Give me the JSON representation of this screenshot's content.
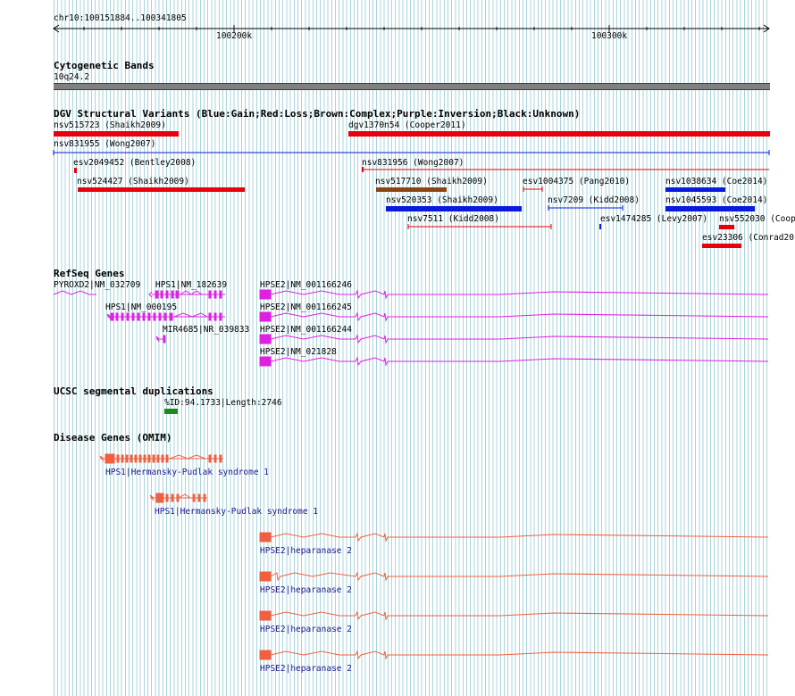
{
  "ruler": {
    "locus": "chr10:100151884..100341805",
    "ticks": [
      "100200k",
      "100300k"
    ]
  },
  "tracks": {
    "cytoband": {
      "title": "Cytogenetic Bands",
      "band": "10q24.2"
    },
    "dgv": {
      "title": "DGV Structural Variants (Blue:Gain;Red:Loss;Brown:Complex;Purple:Inversion;Black:Unknown)",
      "features": [
        "nsv515723 (Shaikh2009)",
        "dgv1370n54 (Cooper2011)",
        "nsv831955 (Wong2007)",
        "esv2049452 (Bentley2008)",
        "nsv831956 (Wong2007)",
        "nsv524427 (Shaikh2009)",
        "nsv517710 (Shaikh2009)",
        "esv1004375 (Pang2010)",
        "nsv1038634 (Coe2014)",
        "nsv520353 (Shaikh2009)",
        "nsv7209 (Kidd2008)",
        "nsv1045593 (Coe2014)",
        "nsv7511 (Kidd2008)",
        "esv1474285 (Levy2007)",
        "nsv552030 (Coop",
        "esv23306 (Conrad20"
      ]
    },
    "refseq": {
      "title": "RefSeq Genes",
      "genes": [
        "PYROXD2|NM_032709",
        "HPS1|NM_182639",
        "HPSE2|NM_001166246",
        "HPS1|NM_000195",
        "HPSE2|NM_001166245",
        "MIR4685|NR_039833",
        "HPSE2|NM_001166244",
        "HPSE2|NM_021828"
      ]
    },
    "segdup": {
      "title": "UCSC segmental duplications",
      "label": "%ID:94.1733|Length:2746"
    },
    "omim": {
      "title": "Disease Genes (OMIM)",
      "genes": [
        "HPS1|Hermansky-Pudlak syndrome 1",
        "HPS1|Hermansky-Pudlak syndrome 1",
        "HPSE2|heparanase 2",
        "HPSE2|heparanase 2",
        "HPSE2|heparanase 2",
        "HPSE2|heparanase 2"
      ]
    }
  },
  "colors": {
    "grid": "#a8d4dc",
    "loss": "#e8000a",
    "gain": "#0a1adc",
    "complex": "#8b4513",
    "refseq": "#e020e0",
    "segdup": "#188c18",
    "omim": "#f06040",
    "omim_label": "#1a1a8c"
  }
}
